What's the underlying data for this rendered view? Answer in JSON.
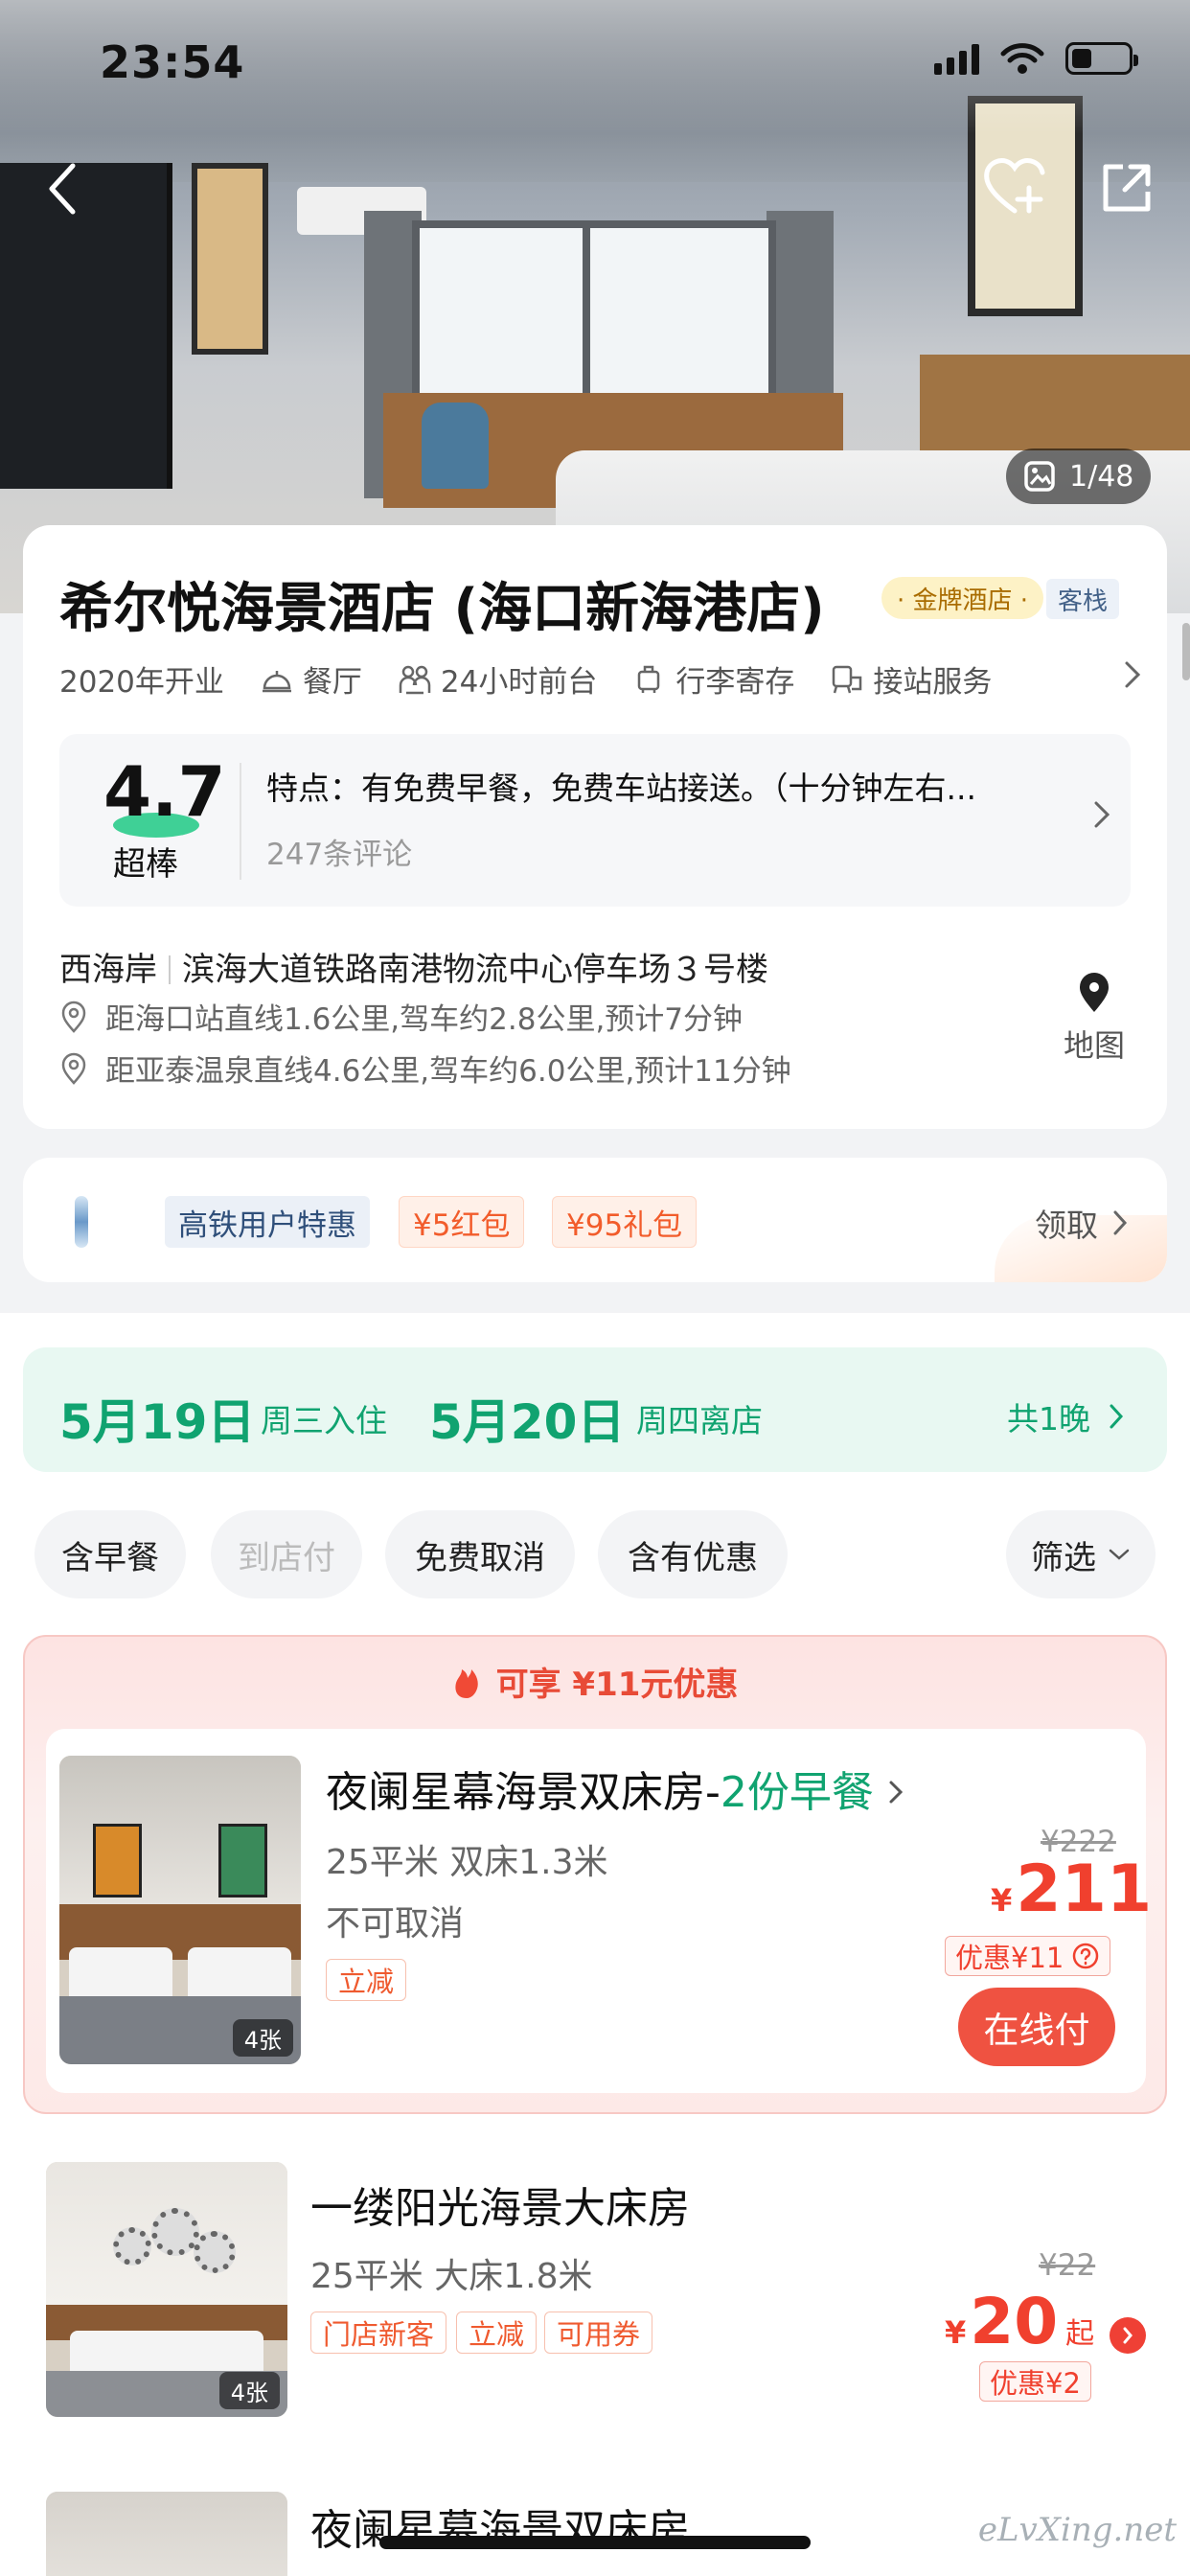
{
  "status_bar": {
    "time": "23:54"
  },
  "hero": {
    "photo_counter": "1/48"
  },
  "hotel": {
    "name": "希尔悦海景酒店 (海口新海港店)",
    "gold_badge": "· 金牌酒店 ·",
    "type_badge": "客栈",
    "facilities": [
      "2020年开业",
      "餐厅",
      "24小时前台",
      "行李寄存",
      "接站服务"
    ],
    "rating": {
      "score": "4.7",
      "label": "超棒",
      "feature": "特点：有免费早餐，免费车站接送。（十分钟左右...",
      "reviews": "247条评论"
    },
    "address": {
      "area": "西海岸",
      "street": "滨海大道铁路南港物流中心停车场３号楼",
      "distance_1": "距海口站直线1.6公里,驾车约2.8公里,预计7分钟",
      "distance_2": "距亚泰温泉直线4.6公里,驾车约6.0公里,预计11分钟",
      "map_label": "地图"
    }
  },
  "promo": {
    "tags": [
      "高铁用户特惠",
      "¥5红包",
      "¥95礼包"
    ],
    "claim_label": "领取"
  },
  "dates": {
    "checkin_date": "5月19日",
    "checkin_label": "周三入住",
    "checkout_date": "5月20日",
    "checkout_label": "周四离店",
    "nights": "共1晚"
  },
  "filters": [
    "含早餐",
    "到店付",
    "免费取消",
    "含有优惠",
    "筛选"
  ],
  "featured_banner": "可享 ¥11元优惠",
  "rooms": [
    {
      "name": "夜阑星幕海景双床房-",
      "breakfast": "2份早餐",
      "spec": "25平米  双床1.3米",
      "policy": "不可取消",
      "tags": [
        "立减"
      ],
      "orig_price": "¥222",
      "currency": "¥",
      "price": "211",
      "savings": "优惠¥11",
      "pay_label": "在线付",
      "photo_count": "4张"
    },
    {
      "name": "一缕阳光海景大床房",
      "spec": "25平米   大床1.8米",
      "tags": [
        "门店新客",
        "立减",
        "可用券"
      ],
      "orig_price": "¥22",
      "currency": "¥",
      "price": "20",
      "price_suffix": "起",
      "savings": "优惠¥2",
      "photo_count": "4张"
    },
    {
      "name": "夜阑星幕海景双床房"
    }
  ],
  "watermark": "eLvXing.net"
}
